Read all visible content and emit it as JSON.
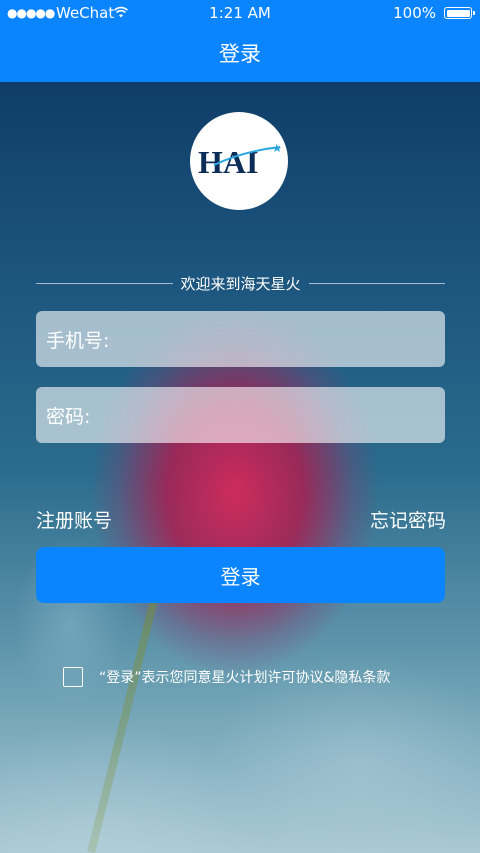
{
  "status_bar": {
    "signal": "●●●●●",
    "carrier": "WeChat",
    "time": "1:21 AM",
    "battery": "100%"
  },
  "nav": {
    "title": "登录"
  },
  "logo": {
    "text": "HAI"
  },
  "welcome": "欢迎来到海天星火",
  "form": {
    "phone_label": "手机号:",
    "phone_value": "",
    "password_label": "密码:",
    "password_value": ""
  },
  "links": {
    "register": "注册账号",
    "forgot": "忘记密码"
  },
  "login_button": "登录",
  "agreement": {
    "checked": false,
    "text": "“登录”表示您同意星火计划许可协议&隐私条款"
  },
  "colors": {
    "accent": "#0a84ff"
  }
}
